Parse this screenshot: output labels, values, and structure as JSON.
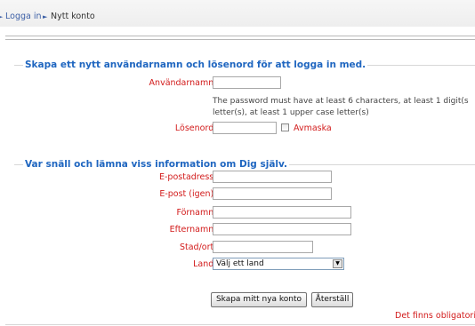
{
  "breadcrumb": {
    "home_label": "Logga in",
    "separator": "►",
    "current": "Nytt konto"
  },
  "account_section": {
    "legend": "Skapa ett nytt användarnamn och lösenord för att logga in med.",
    "username_label": "Användarnamn",
    "username_value": "",
    "password_help_line1": "The password must have at least 6 characters, at least 1 digit(s",
    "password_help_line2": "letter(s), at least 1 upper case letter(s)",
    "password_label": "Lösenord",
    "password_value": "",
    "unmask_label": "Avmaska"
  },
  "info_section": {
    "legend": "Var snäll och lämna viss information om Dig själv.",
    "email_label": "E-postadress",
    "email_confirm_label": "E-post (igen)",
    "firstname_label": "Förnamn",
    "lastname_label": "Efternamn",
    "city_label": "Stad/ort",
    "country_label": "Land",
    "country_selected": "Välj ett land"
  },
  "required_marker": "*",
  "buttons": {
    "submit_label": "Skapa mitt nya konto",
    "reset_label": "Återställ"
  },
  "required_note": "Det finns obligatoris",
  "colors": {
    "legend_blue": "#1f66c0",
    "label_red": "#d21b1b",
    "link_blue": "#3c5fa6"
  }
}
